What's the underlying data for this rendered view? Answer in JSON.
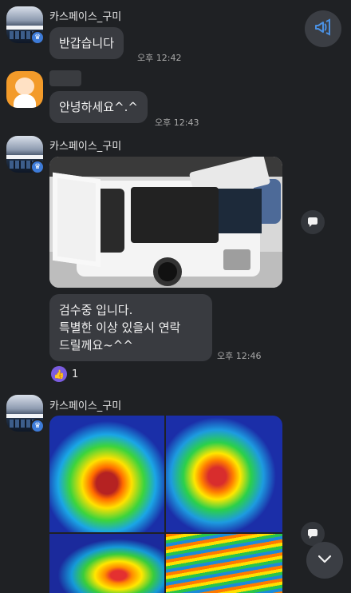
{
  "accent": "#3d7bd8",
  "messages": {
    "m1": {
      "sender": "카스페이스_구미",
      "text": "반갑습니다",
      "time": "오후 12:42"
    },
    "m2": {
      "text": "안녕하세요^.^",
      "time": "오후 12:43"
    },
    "m3": {
      "sender": "카스페이스_구미",
      "text": "검수중 입니다.\n특별한 이상 있을시 연락\n드릴께요~^^",
      "time": "오후 12:46",
      "reaction_count": "1"
    },
    "m4": {
      "sender": "카스페이스_구미"
    }
  },
  "icons": {
    "notice": "megaphone-icon",
    "share": "share-bubble-icon",
    "scroll": "chevron-down-icon",
    "reaction": "thumbs-up-icon",
    "badge": "crown-icon"
  }
}
